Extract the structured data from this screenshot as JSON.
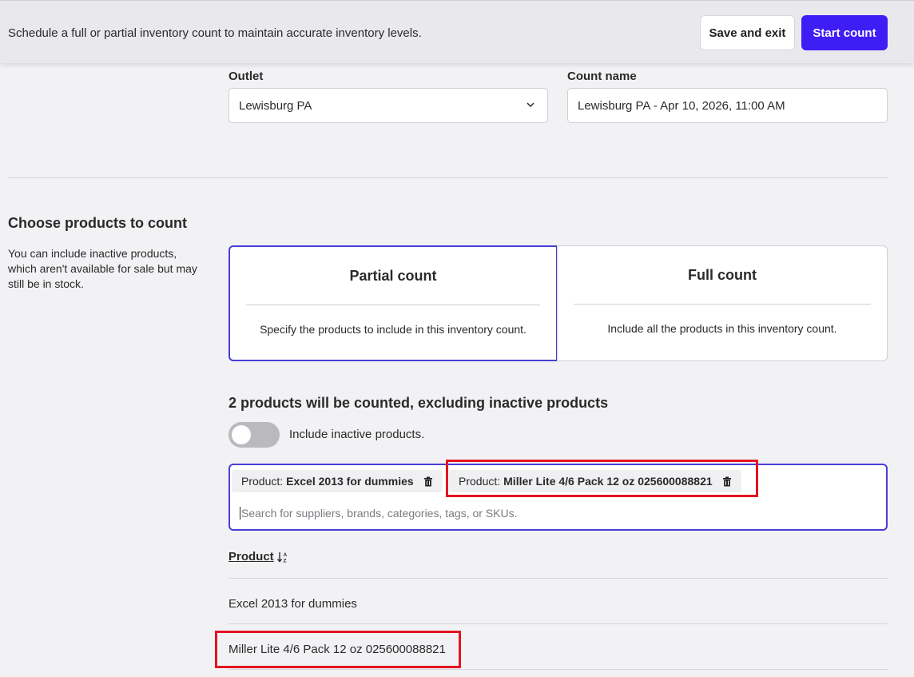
{
  "header": {
    "description": "Schedule a full or partial inventory count to maintain accurate inventory levels.",
    "save_exit_label": "Save and exit",
    "start_count_label": "Start count"
  },
  "form": {
    "outlet_label": "Outlet",
    "outlet_value": "Lewisburg PA",
    "count_name_label": "Count name",
    "count_name_value": "Lewisburg PA - Apr 10, 2026, 11:00 AM"
  },
  "products_section": {
    "title": "Choose products to count",
    "description": "You can include inactive products, which aren't available for sale but may still be in stock.",
    "partial": {
      "title": "Partial count",
      "description": "Specify the products to include in this inventory count.",
      "selected": true
    },
    "full": {
      "title": "Full count",
      "description": "Include all the products in this inventory count."
    },
    "count_heading": "2 products will be counted, excluding inactive products",
    "toggle_label": "Include inactive products.",
    "toggle_on": false,
    "tags": [
      {
        "prefix": "Product:",
        "value": "Excel 2013 for dummies"
      },
      {
        "prefix": "Product:",
        "value": "Miller Lite 4/6 Pack 12 oz 025600088821"
      }
    ],
    "search_placeholder": "Search for suppliers, brands, categories, tags, or SKUs.",
    "column_header": "Product",
    "rows": [
      "Excel 2013 for dummies",
      "Miller Lite 4/6 Pack 12 oz 025600088821"
    ]
  },
  "colors": {
    "primary": "#3f1df5",
    "selected_border": "#4a3fd6",
    "highlight": "#e3141e"
  },
  "icons": [
    "chevron-down-icon",
    "trash-icon",
    "sort-az-icon"
  ]
}
